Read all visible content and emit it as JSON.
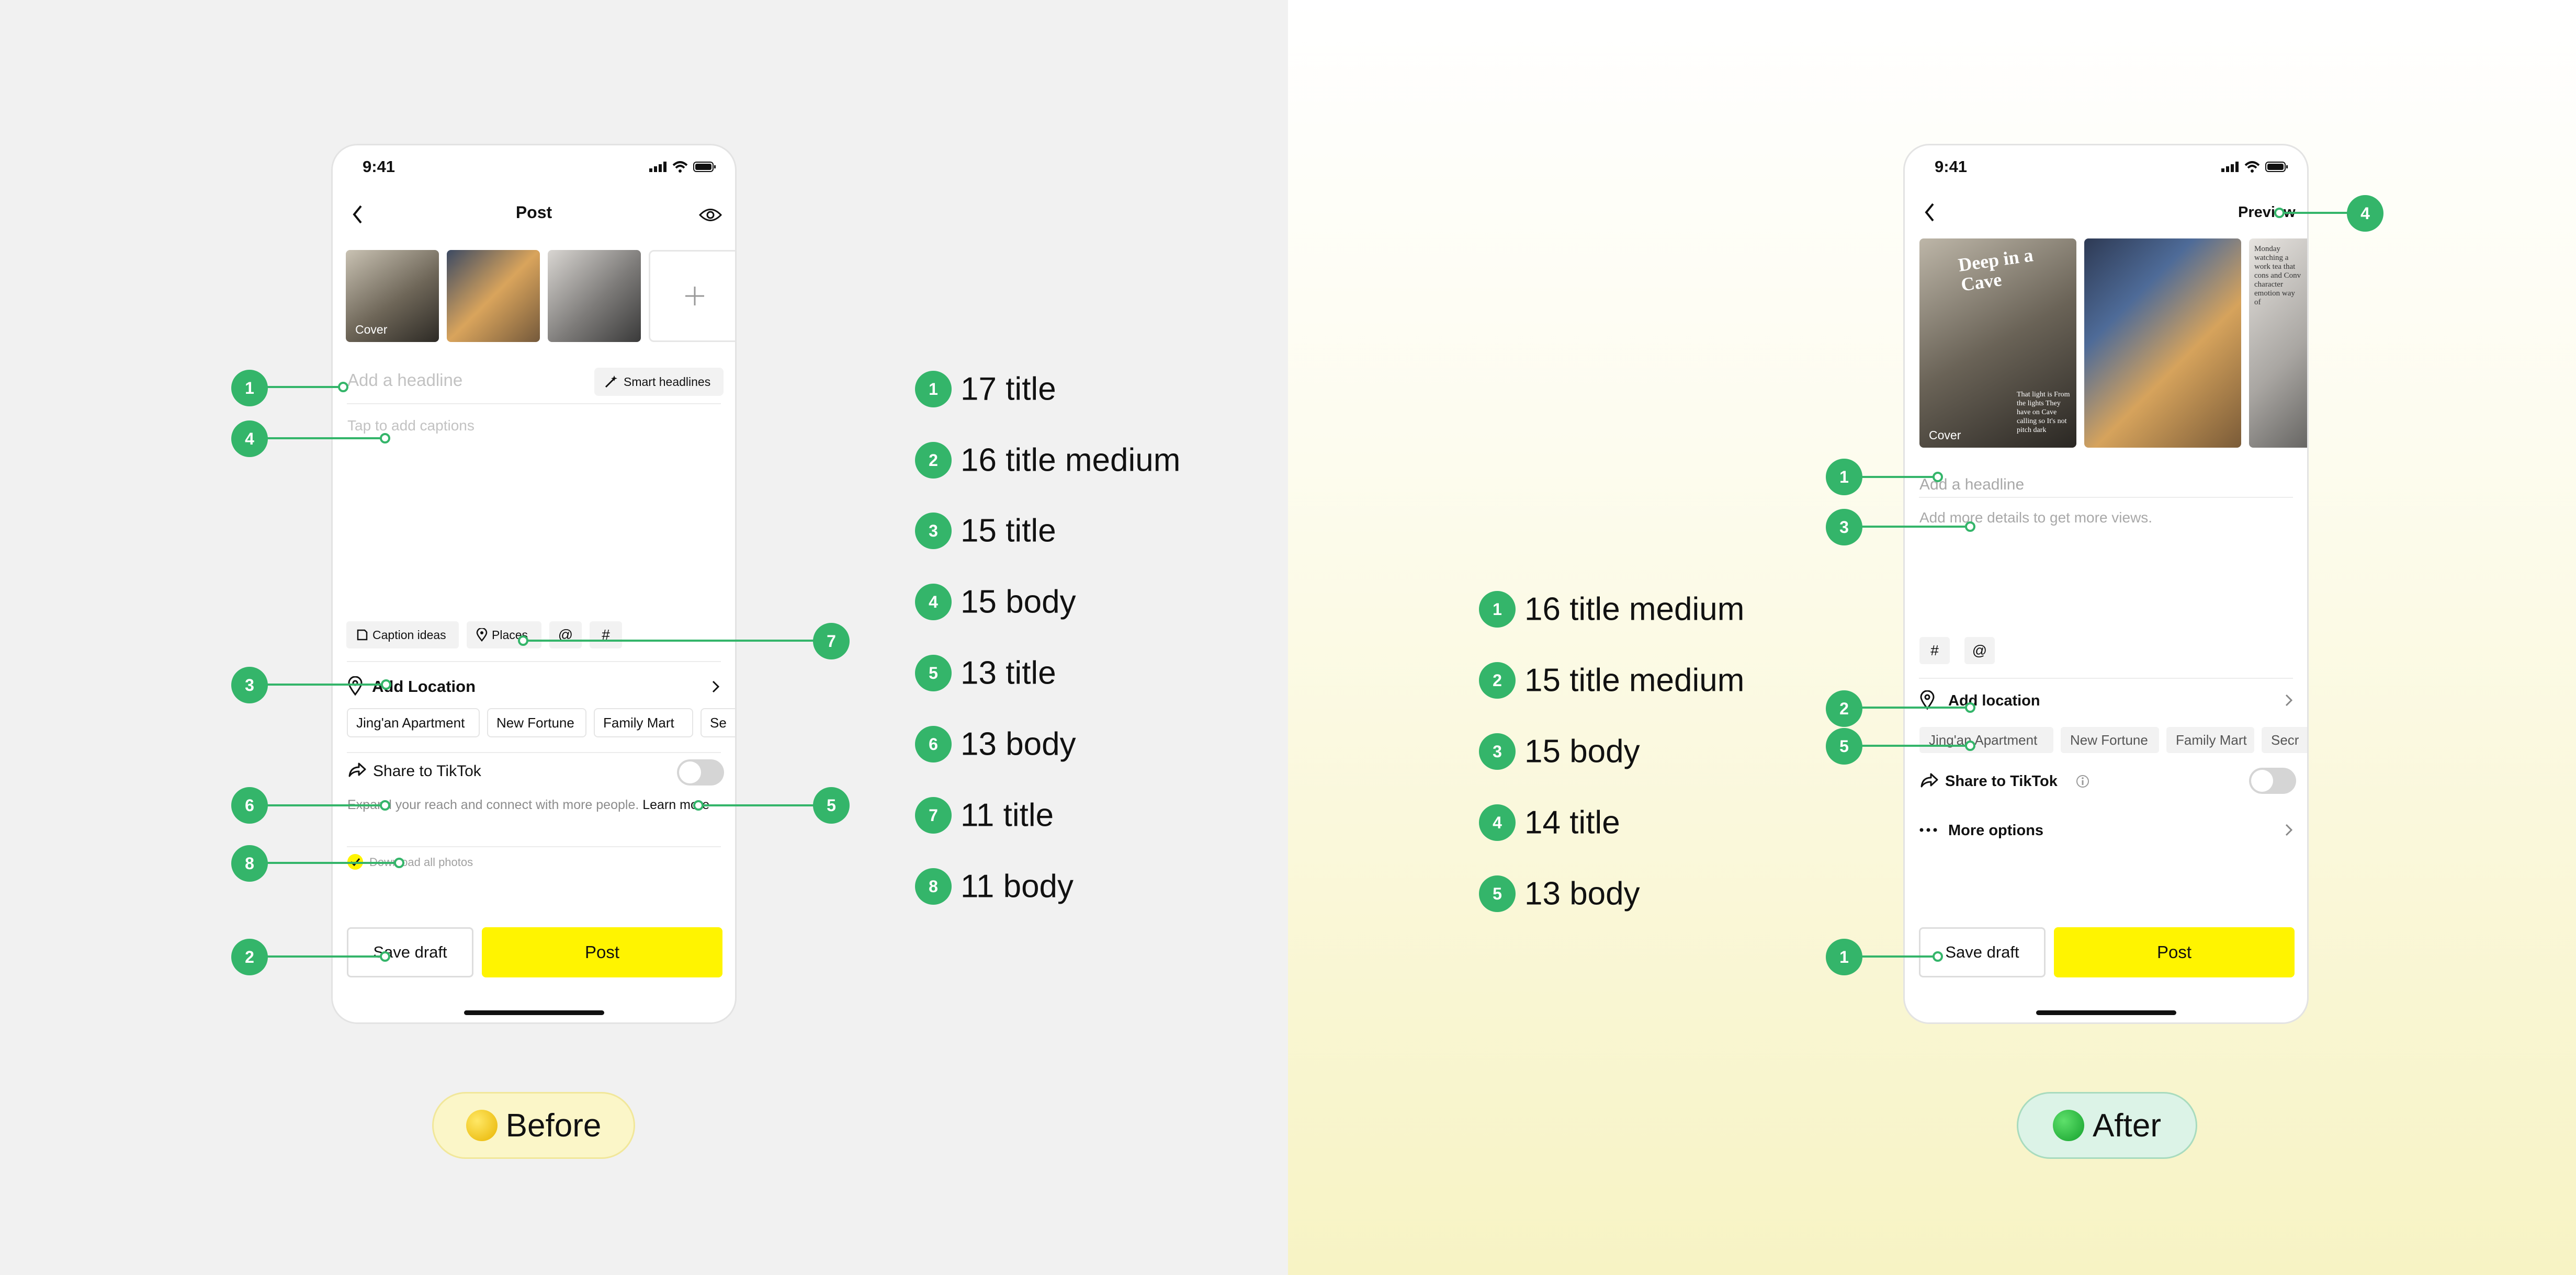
{
  "before": {
    "pill_label": "Before",
    "status_time": "9:41",
    "nav_title": "Post",
    "cover_label": "Cover",
    "headline_placeholder": "Add a headline",
    "smart_headlines": "Smart headlines",
    "caption_placeholder": "Tap to add captions",
    "toolbar": {
      "caption_ideas": "Caption ideas",
      "places": "Places"
    },
    "add_location": "Add Location",
    "location_chips": [
      "Jing'an Apartment",
      "New Fortune",
      "Family Mart",
      "Se"
    ],
    "share_label": "Share to TikTok",
    "share_desc": "Expand your reach and connect with more people.",
    "learn_more": "Learn more",
    "download_label": "Download all photos",
    "save_draft": "Save draft",
    "post": "Post",
    "callouts": [
      "1",
      "4",
      "3",
      "6",
      "8",
      "2",
      "7",
      "5"
    ]
  },
  "before_legend": [
    {
      "num": "1",
      "text": "17 title"
    },
    {
      "num": "2",
      "text": "16 title medium"
    },
    {
      "num": "3",
      "text": "15 title"
    },
    {
      "num": "4",
      "text": "15 body"
    },
    {
      "num": "5",
      "text": "13 title"
    },
    {
      "num": "6",
      "text": "13 body"
    },
    {
      "num": "7",
      "text": "11 title"
    },
    {
      "num": "8",
      "text": "11 body"
    }
  ],
  "after": {
    "pill_label": "After",
    "status_time": "9:41",
    "preview": "Preview",
    "cover_label": "Cover",
    "thumb1_text": "Deep in a Cave",
    "thumb1_subtext": "That light is From the lights They have on Cave calling so It's not pitch dark",
    "thumb3_text": "Monday watching a work tea that cons and Conv character emotion way of",
    "headline_placeholder": "Add a headline",
    "details_placeholder": "Add more details to get more views.",
    "add_location": "Add location",
    "location_chips": [
      "Jing'an Apartment",
      "New Fortune",
      "Family Mart",
      "Secr"
    ],
    "share_label": "Share to TikTok",
    "more_options": "More options",
    "save_draft": "Save draft",
    "post": "Post",
    "callouts": [
      "4",
      "1",
      "3",
      "2",
      "5",
      "1"
    ]
  },
  "after_legend": [
    {
      "num": "1",
      "text": "16 title medium"
    },
    {
      "num": "2",
      "text": "15 title medium"
    },
    {
      "num": "3",
      "text": "15 body"
    },
    {
      "num": "4",
      "text": "14 title"
    },
    {
      "num": "5",
      "text": "13 body"
    }
  ],
  "colors": {
    "accent_yellow": "#fff400",
    "callout_green": "#34b56a",
    "before_bg": "#f1f1f1"
  }
}
